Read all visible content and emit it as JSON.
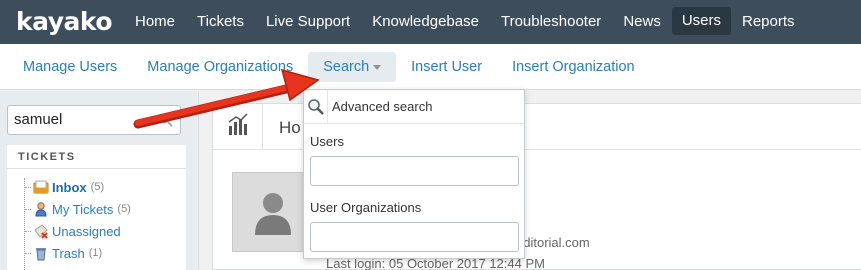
{
  "app": {
    "logo": "kayako"
  },
  "topnav": {
    "items": [
      {
        "label": "Home"
      },
      {
        "label": "Tickets"
      },
      {
        "label": "Live Support"
      },
      {
        "label": "Knowledgebase"
      },
      {
        "label": "Troubleshooter"
      },
      {
        "label": "News"
      },
      {
        "label": "Users",
        "active": true
      },
      {
        "label": "Reports"
      }
    ]
  },
  "subnav": {
    "items": [
      {
        "label": "Manage Users"
      },
      {
        "label": "Manage Organizations"
      },
      {
        "label": "Search",
        "active": true,
        "has_caret": true
      },
      {
        "label": "Insert User"
      },
      {
        "label": "Insert Organization"
      }
    ]
  },
  "sidebar": {
    "search": {
      "value": "samuel",
      "icon": "search-icon"
    },
    "tickets": {
      "title": "TICKETS",
      "items": [
        {
          "label": "Inbox",
          "count": "(5)",
          "icon": "inbox-icon",
          "bold": true
        },
        {
          "label": "My Tickets",
          "count": "(5)",
          "icon": "user-icon"
        },
        {
          "label": "Unassigned",
          "count": "",
          "icon": "unassigned-icon"
        },
        {
          "label": "Trash",
          "count": "(1)",
          "icon": "trash-icon"
        }
      ]
    }
  },
  "main": {
    "title": "Ho",
    "email_fragment": "editorial.com",
    "last_login": "Last login: 05 October 2017 12:44 PM"
  },
  "search_dropdown": {
    "advanced_label": "Advanced search",
    "users_label": "Users",
    "users_value": "",
    "orgs_label": "User Organizations",
    "orgs_value": ""
  },
  "colors": {
    "topbar": "#3e4d5c",
    "link": "#2a7fb5",
    "annotation_arrow": "#e8331f"
  }
}
